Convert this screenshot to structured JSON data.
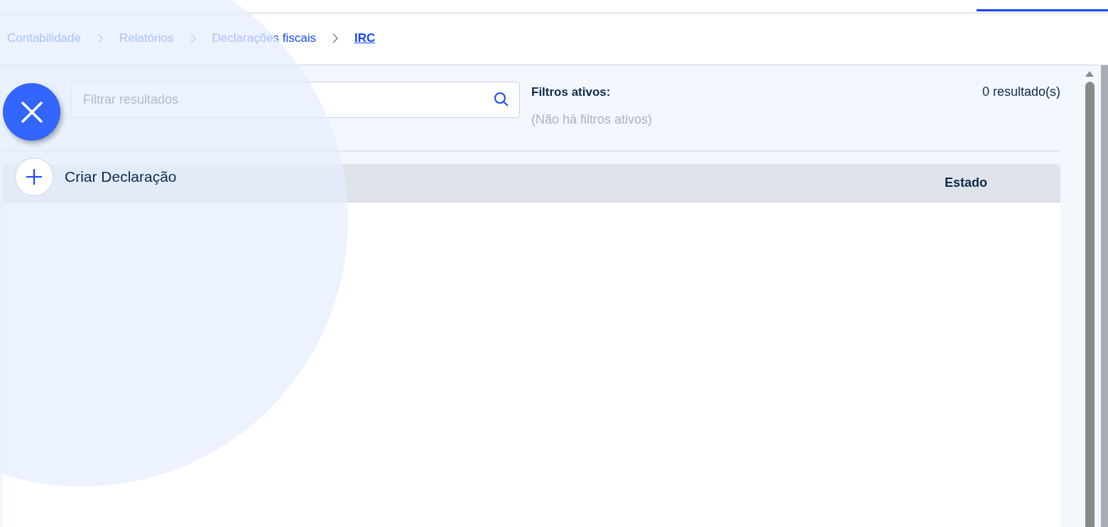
{
  "breadcrumb": [
    {
      "label": "Contabilidade",
      "current": false
    },
    {
      "label": "Relatórios",
      "current": false
    },
    {
      "label": "Declarações fiscais",
      "current": false
    },
    {
      "label": "IRC",
      "current": true
    }
  ],
  "filter": {
    "placeholder": "Filtrar resultados"
  },
  "active_filters": {
    "label": "Filtros ativos:",
    "empty_text": "(Não há filtros ativos)"
  },
  "results_count": "0 resultado(s)",
  "table": {
    "columns": [
      "Estado"
    ]
  },
  "fab_menu": {
    "expanded": true,
    "actions": [
      {
        "label": "Criar Declaração"
      }
    ]
  }
}
